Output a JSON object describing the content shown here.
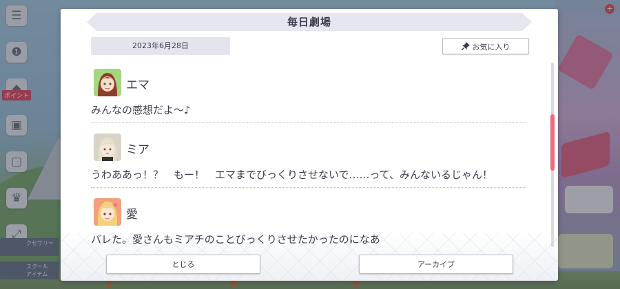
{
  "dialog": {
    "title": "毎日劇場",
    "date": "2023年6月28日",
    "favorite_label": "お気に入り",
    "favorite_icon": "pin-icon",
    "entries": [
      {
        "name": "エマ",
        "line": "みんなの感想だよ～♪",
        "avatar_color": "#a6d67f",
        "hair_color": "#8b3e2b"
      },
      {
        "name": "ミア",
        "line": "うわああっ！？　もー！　エマまでびっくりさせないで……って、みんないるじゃん！",
        "avatar_color": "#d9d4c8",
        "hair_color": "#cfc6b0"
      },
      {
        "name": "愛",
        "line": "バレた。愛さんもミアチのことびっくりさせたかったのになあ",
        "avatar_color": "#f2a07d",
        "hair_color": "#f3d07a"
      }
    ],
    "close_label": "とじる",
    "archive_label": "アーカイブ",
    "accent_color": "#ee6b7e"
  },
  "background": {
    "side_tag": "ポイント",
    "side_card_1": "クセサリー",
    "side_card_2": "スクール\nアイテム"
  }
}
